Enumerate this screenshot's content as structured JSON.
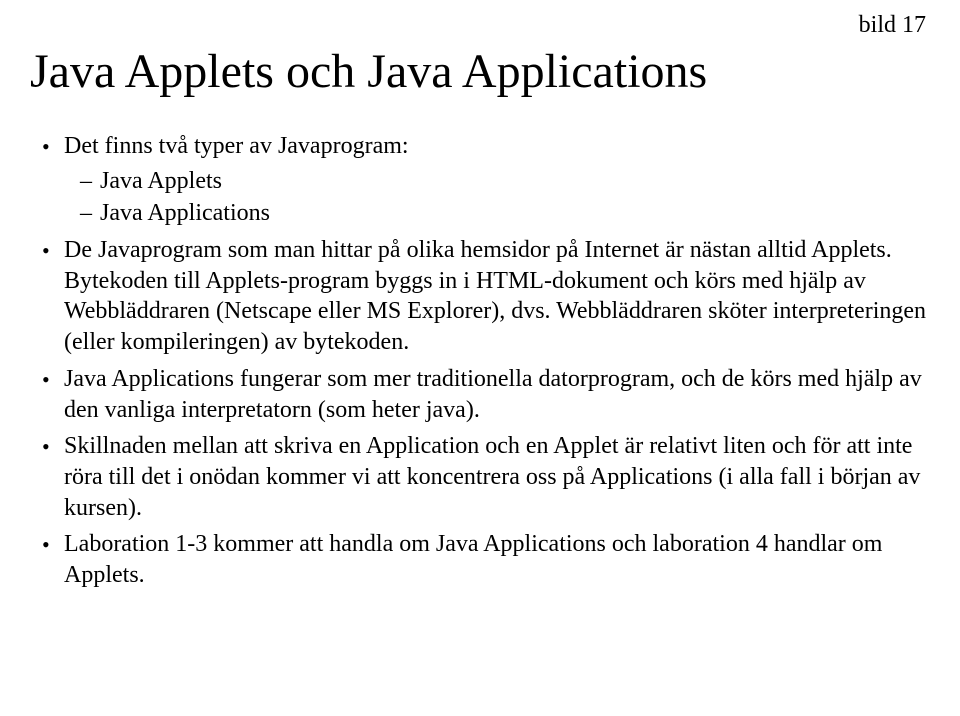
{
  "slideLabel": "bild 17",
  "title": "Java Applets och Java Applications",
  "bullets": {
    "b1": "Det finns två typer av Javaprogram:",
    "b1_sub1": "Java Applets",
    "b1_sub2": "Java Applications",
    "b2": "De Javaprogram som man hittar på olika hemsidor på Internet är nästan alltid Applets. Bytekoden till Applets-program byggs in i HTML-dokument och körs med hjälp av Webbläddraren (Netscape eller MS Explorer), dvs. Webbläddraren sköter interpreteringen (eller kompileringen) av bytekoden.",
    "b3": "Java Applications fungerar som mer traditionella datorprogram, och de körs med hjälp av den vanliga interpretatorn (som heter java).",
    "b4": "Skillnaden mellan att skriva en Application och en Applet är relativt liten och för att inte röra till det i onödan kommer vi att koncentrera oss på Applications (i alla fall i början av kursen).",
    "b5": "Laboration 1-3 kommer att handla om Java Applications och laboration 4 handlar om Applets."
  }
}
